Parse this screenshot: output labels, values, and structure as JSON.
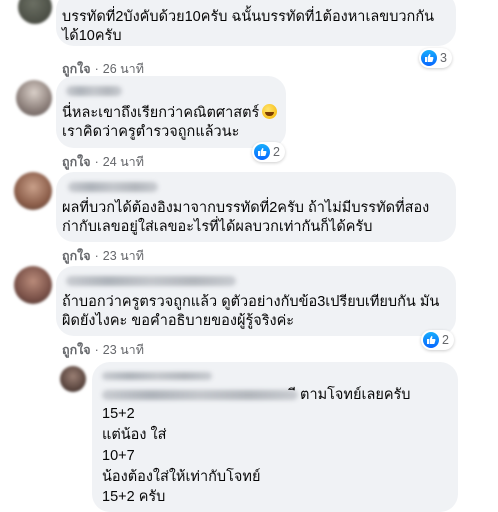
{
  "comments": [
    {
      "lines": [
        "บรรทัดที่2บังคับด้วย10ครับ ฉนั้นบรรทัดที่1ต้องหาเลขบวกกัน",
        "ได้10ครับ"
      ],
      "like_label": "ถูกใจ",
      "time": "26 นาที",
      "reaction_count": "3"
    },
    {
      "lines": [
        "นี่หละเขาถึงเรียกว่าคณิตศาสตร์",
        "เราคิดว่าครูตำรวจถูกแล้วนะ"
      ],
      "like_label": "ถูกใจ",
      "time": "24 นาที",
      "reaction_count": "2",
      "emoji": "rofl-emoji"
    },
    {
      "lines": [
        "ผลที่บวกได้ต้องอิงมาจากบรรทัดที่2ครับ ถ้าไม่มีบรรทัดที่สอง",
        "ก่ากับเลขอยู่ใส่เลขอะไรที่ได้ผลบวกเท่ากันก็ได้ครับ"
      ],
      "like_label": "ถูกใจ",
      "time": "23 นาที"
    },
    {
      "lines": [
        "ถ้าบอกว่าครูตรวจถูกแล้ว ดูตัวอย่างกับข้อ3เปรียบเทียบกัน มัน",
        "ผิดยังไงคะ ขอคำอธิบายของผู้รู้จริงค่ะ"
      ],
      "like_label": "ถูกใจ",
      "time": "23 นาที",
      "reaction_count": "2"
    }
  ],
  "reply": {
    "first_line_suffix": "ี ตามโจทย์เลยครับ",
    "lines": [
      "15+2",
      "แต่น้อง ใส่",
      "10+7",
      "น้องต้องใส่ให้เท่ากับโจทย์",
      "15+2 ครับ"
    ]
  },
  "colors": {
    "bubble": "#f0f2f5",
    "meta_text": "#65676b",
    "like_blue": "#0866ff"
  }
}
